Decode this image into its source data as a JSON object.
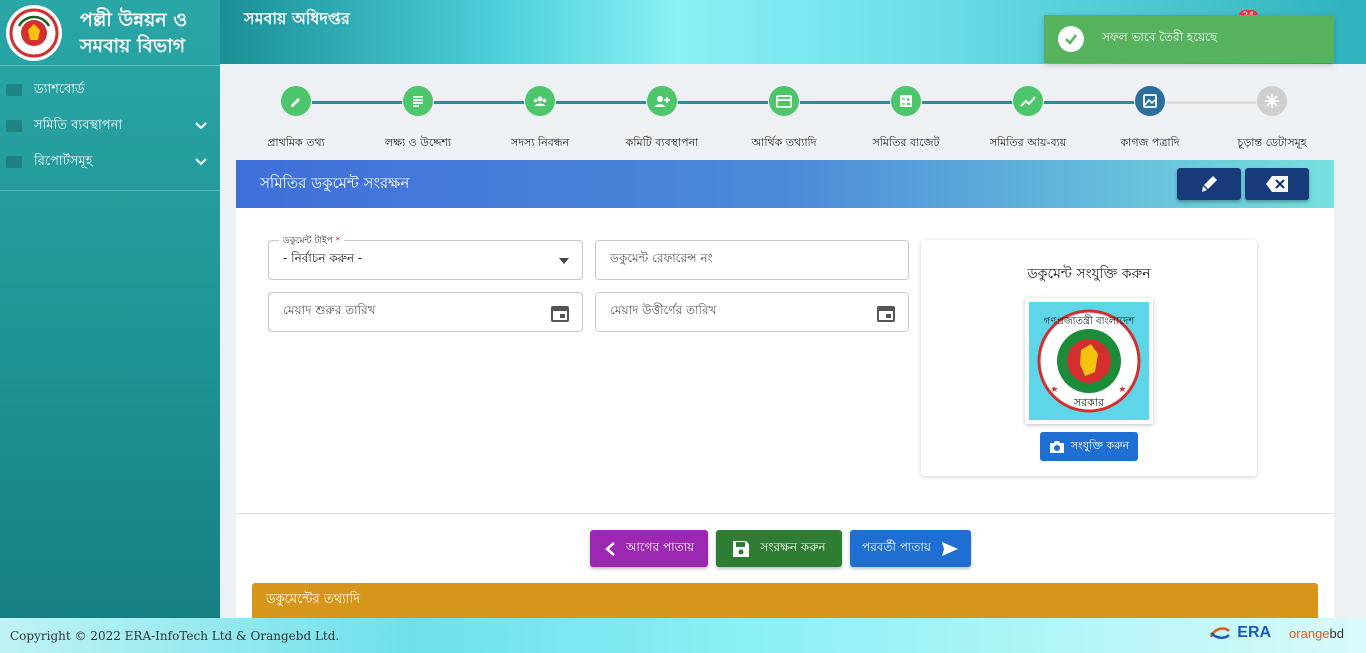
{
  "sidebar": {
    "brand_line1": "পল্লী উন্নয়ন ও",
    "brand_line2": "সমবায় বিভাগ",
    "items": [
      {
        "label": "ড্যাশবোর্ড",
        "expandable": false
      },
      {
        "label": "সমিতি ব্যবস্থাপনা",
        "expandable": true
      },
      {
        "label": "রিপোর্টসমূহ",
        "expandable": true
      }
    ]
  },
  "header": {
    "title": "সমবায় অধিদপ্তর",
    "notification_count": "24"
  },
  "toast": {
    "message": "সফল ভাবে তৈরী হয়েছে",
    "color": "#57b25d"
  },
  "stepper": {
    "active_color": "#4cc56b",
    "current_color": "#2c6f9a",
    "pending_color": "#cfcfcf",
    "steps": [
      {
        "label": "প্রাথমিক তথ্য",
        "state": "done",
        "icon": "pencil-icon"
      },
      {
        "label": "লক্ষ্য ও উদ্দেশ্য",
        "state": "done",
        "icon": "notes-icon"
      },
      {
        "label": "সদস্য নিবন্ধন",
        "state": "done",
        "icon": "group-icon"
      },
      {
        "label": "কমিটি ব্যবস্থাপনা",
        "state": "done",
        "icon": "person-add-icon"
      },
      {
        "label": "আর্থিক তথ্যাদি",
        "state": "done",
        "icon": "card-icon"
      },
      {
        "label": "সমিতির বাজেট",
        "state": "done",
        "icon": "calculator-icon"
      },
      {
        "label": "সমিতির আয়-ব্যয়",
        "state": "done",
        "icon": "trend-icon"
      },
      {
        "label": "কাগজ পত্রাদি",
        "state": "current",
        "icon": "image-icon"
      },
      {
        "label": "চূড়ান্ত ডেটাসমূহ",
        "state": "pending",
        "icon": "snowflake-icon"
      }
    ]
  },
  "card": {
    "title": "সমিতির ডকুমেন্ট সংরক্ষন",
    "doc_type_label": "ডকুমেন্ট টাইপ",
    "doc_type_value": "- নির্বাচন করুন -",
    "doc_ref_placeholder": "ডকুমেন্ট রেফারেন্স নং",
    "start_date_placeholder": "মেয়াদ শুরুর তারিখ",
    "end_date_placeholder": "মেয়াদ উত্তীর্ণের তারিখ",
    "attach_title": "ডকুমেন্ট সংযুক্তি করুন",
    "attach_button": "সংযুক্তি করুন",
    "seal_top": "গণপ্রজাতন্ত্রী বাংলাদেশ",
    "seal_bottom": "সরকার"
  },
  "actions": {
    "prev_label": "আগের পাতায়",
    "save_label": "সংরক্ষন করুন",
    "next_label": "পরবর্তী পাতায়",
    "prev_color": "#9c27b0",
    "save_color": "#2e7d32",
    "next_color": "#1e6fd1"
  },
  "doc_section": {
    "title": "ডকুমেন্টের তথ্যাদি"
  },
  "footer": {
    "copyright": "Copyright © 2022 ERA-InfoTech Ltd & Orangebd Ltd.",
    "logo1": "ERA",
    "logo2_a": "orange",
    "logo2_b": "bd"
  }
}
